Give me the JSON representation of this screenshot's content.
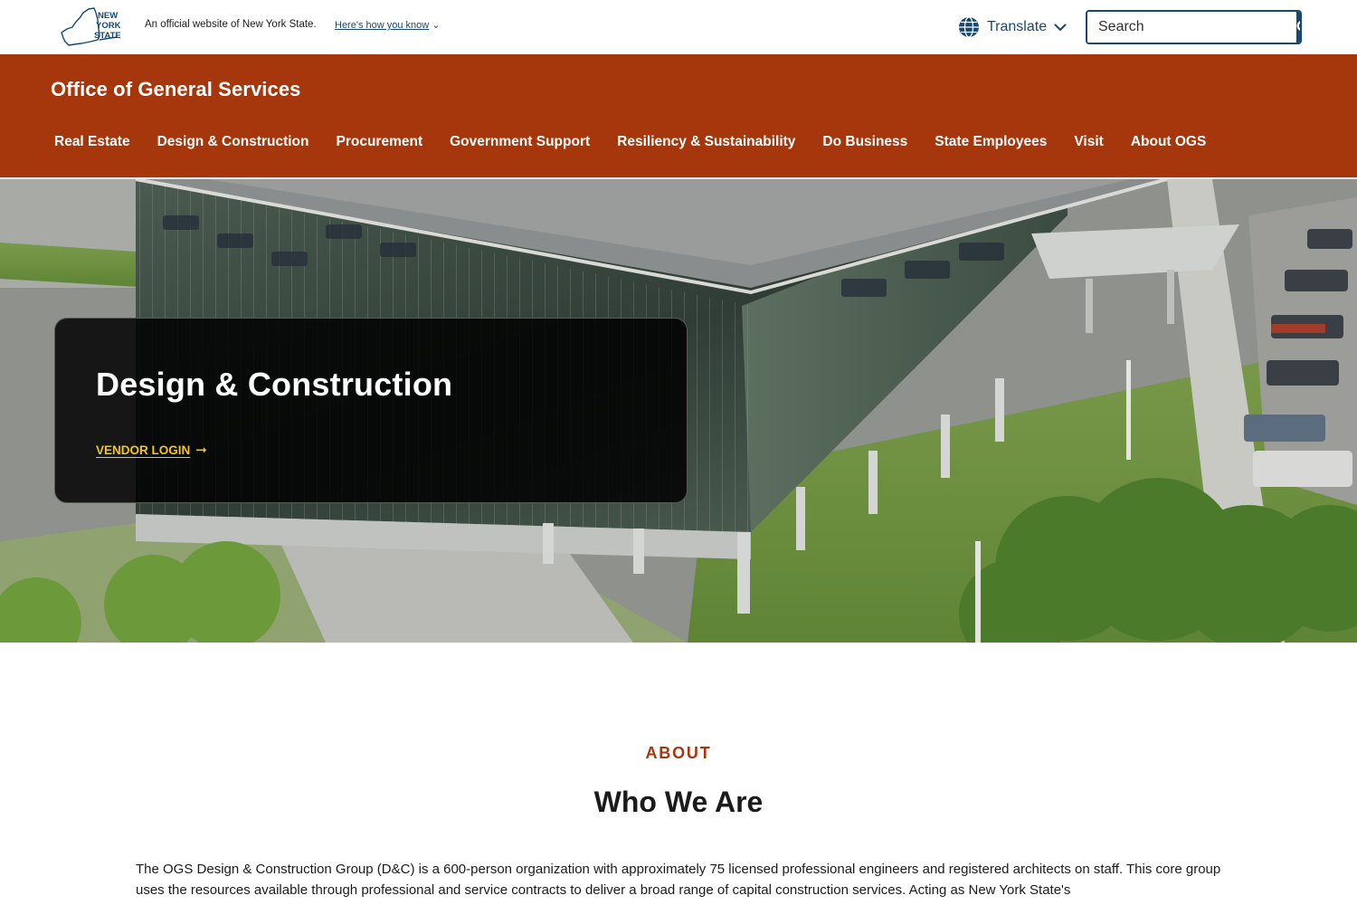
{
  "universal_header": {
    "logo_text": "NEW YORK STATE",
    "official_text": "An official website of New York State.",
    "how_you_know": "Here's how you know",
    "translate_label": "Translate",
    "search_placeholder": "Search"
  },
  "agency": {
    "name": "Office of General Services",
    "nav": [
      "Real Estate",
      "Design & Construction",
      "Procurement",
      "Government Support",
      "Resiliency & Sustainability",
      "Do Business",
      "State Employees",
      "Visit",
      "About OGS"
    ]
  },
  "hero": {
    "title": "Design & Construction",
    "link_label": "VENDOR LOGIN",
    "link_icon": "arrow-right-icon"
  },
  "about": {
    "eyebrow": "ABOUT",
    "title": "Who We Are",
    "body": "The OGS Design & Construction Group (D&C) is a 600-person organization with approximately 75 licensed professional engineers and registered architects on staff. This core group uses the resources available through professional and service contracts to deliver a broad range of capital construction services. Acting as New York State's"
  },
  "colors": {
    "brand_orange": "#a6360c",
    "nys_blue": "#154973",
    "link_yellow": "#f3c518"
  }
}
